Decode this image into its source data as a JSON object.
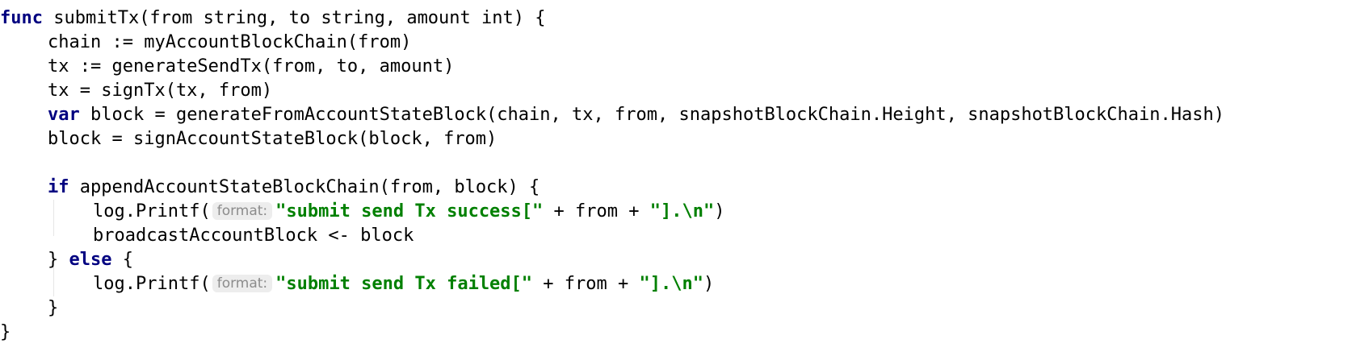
{
  "editor": {
    "language": "go",
    "keyword_color": "#000080",
    "string_color": "#008000",
    "inlay_hint_color": "#8c8c8c",
    "lines": [
      {
        "kw": "func",
        "text": " submitTx(from string, to string, amount int) {"
      },
      {
        "text": "chain := myAccountBlockChain(from)"
      },
      {
        "text": "tx := generateSendTx(from, to, amount)"
      },
      {
        "text": "tx = signTx(tx, from)"
      },
      {
        "kw": "var",
        "text": " block = generateFromAccountStateBlock(chain, tx, from, snapshotBlockChain.Height, snapshotBlockChain.Hash)"
      },
      {
        "text": "block = signAccountStateBlock(block, from)"
      },
      {
        "text": ""
      },
      {
        "kw": "if",
        "text": " appendAccountStateBlockChain(from, block) {"
      },
      {
        "pre": "log.Printf(",
        "hint": "format:",
        "str1": "\"submit send Tx success[\"",
        "mid": " + from + ",
        "str2": "\"].\\n\"",
        "post": ")"
      },
      {
        "text": "broadcastAccountBlock <- block"
      },
      {
        "pre": "} ",
        "kw": "else",
        "post": " {"
      },
      {
        "pre": "log.Printf(",
        "hint": "format:",
        "str1": "\"submit send Tx failed[\"",
        "mid": " + from + ",
        "str2": "\"].\\n\"",
        "post": ")"
      },
      {
        "text": "}"
      },
      {
        "text": "}"
      }
    ]
  }
}
